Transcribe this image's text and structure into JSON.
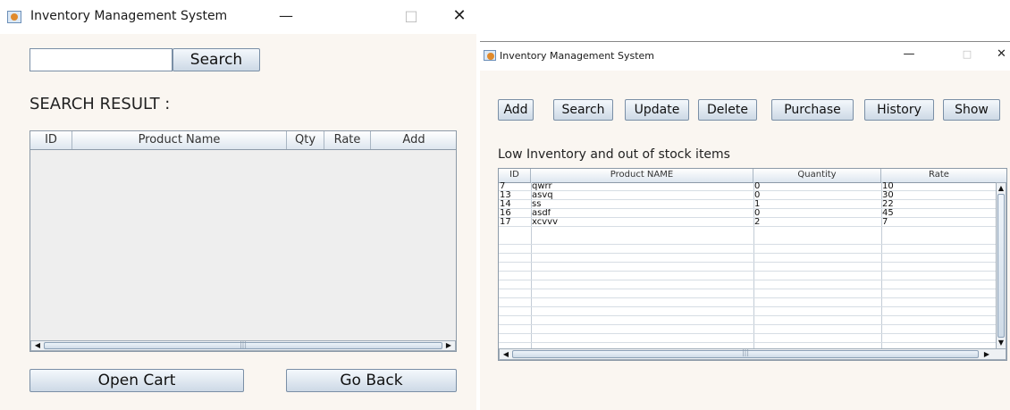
{
  "left": {
    "title": "Inventory Management System",
    "controls": {
      "minimize": "—",
      "maximize": "□",
      "close": "✕"
    },
    "search_button": "Search",
    "search_value": "",
    "result_label": "SEARCH RESULT :",
    "columns": [
      "ID",
      "Product Name",
      "Qty",
      "Rate",
      "Add"
    ],
    "scroll_mid": "|||",
    "open_cart": "Open Cart",
    "go_back": "Go Back"
  },
  "right": {
    "title": "Inventory Management System",
    "controls": {
      "minimize": "—",
      "maximize": "□",
      "close": "✕"
    },
    "toolbar": [
      "Add",
      "Search",
      "Update",
      "Delete",
      "Purchase",
      "History",
      "Show"
    ],
    "section_label": "Low Inventory and out of stock items",
    "columns": [
      "ID",
      "Product NAME",
      "Quantity",
      "Rate"
    ],
    "rows": [
      {
        "id": "7",
        "name": "qwrr",
        "qty": "0",
        "rate": "10"
      },
      {
        "id": "13",
        "name": "asvq",
        "qty": "0",
        "rate": "30"
      },
      {
        "id": "14",
        "name": "ss",
        "qty": "1",
        "rate": "22"
      },
      {
        "id": "16",
        "name": "asdf",
        "qty": "0",
        "rate": "45"
      },
      {
        "id": "17",
        "name": "xcvvv",
        "qty": "2",
        "rate": "7"
      }
    ],
    "scroll_mid": "|||"
  }
}
